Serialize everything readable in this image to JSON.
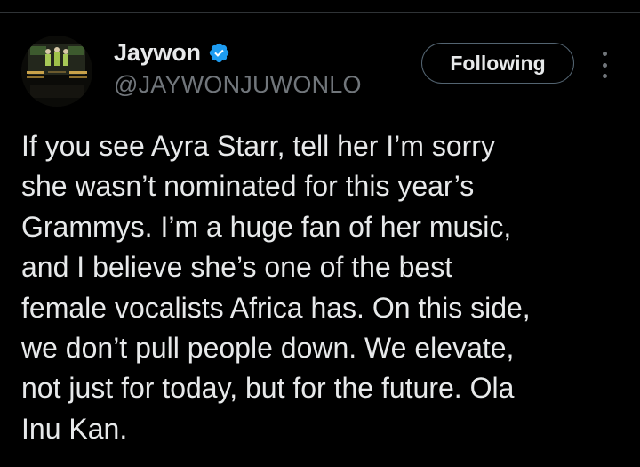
{
  "author": {
    "display_name": "Jaywon",
    "handle": "@JAYWONJUWONLO",
    "verified": true,
    "avatar_icon": "avatar-photo"
  },
  "actions": {
    "follow_label": "Following",
    "more_icon": "more-options-icon"
  },
  "tweet": {
    "lines": [
      "If you see Ayra Starr, tell her I’m sorry",
      "she wasn’t nominated for this year’s",
      "Grammys. I’m a huge fan of her music,",
      "and I believe she’s one of the best",
      "female vocalists Africa has. On this side,",
      "we don’t pull people down. We elevate,",
      "not just for today, but for the future. Ola",
      "Inu Kan."
    ]
  },
  "colors": {
    "background": "#000000",
    "text_primary": "#e7e9ea",
    "text_secondary": "#71767b",
    "verified_badge": "#1d9bf0",
    "button_border": "#536471",
    "divider": "#2f3336"
  }
}
